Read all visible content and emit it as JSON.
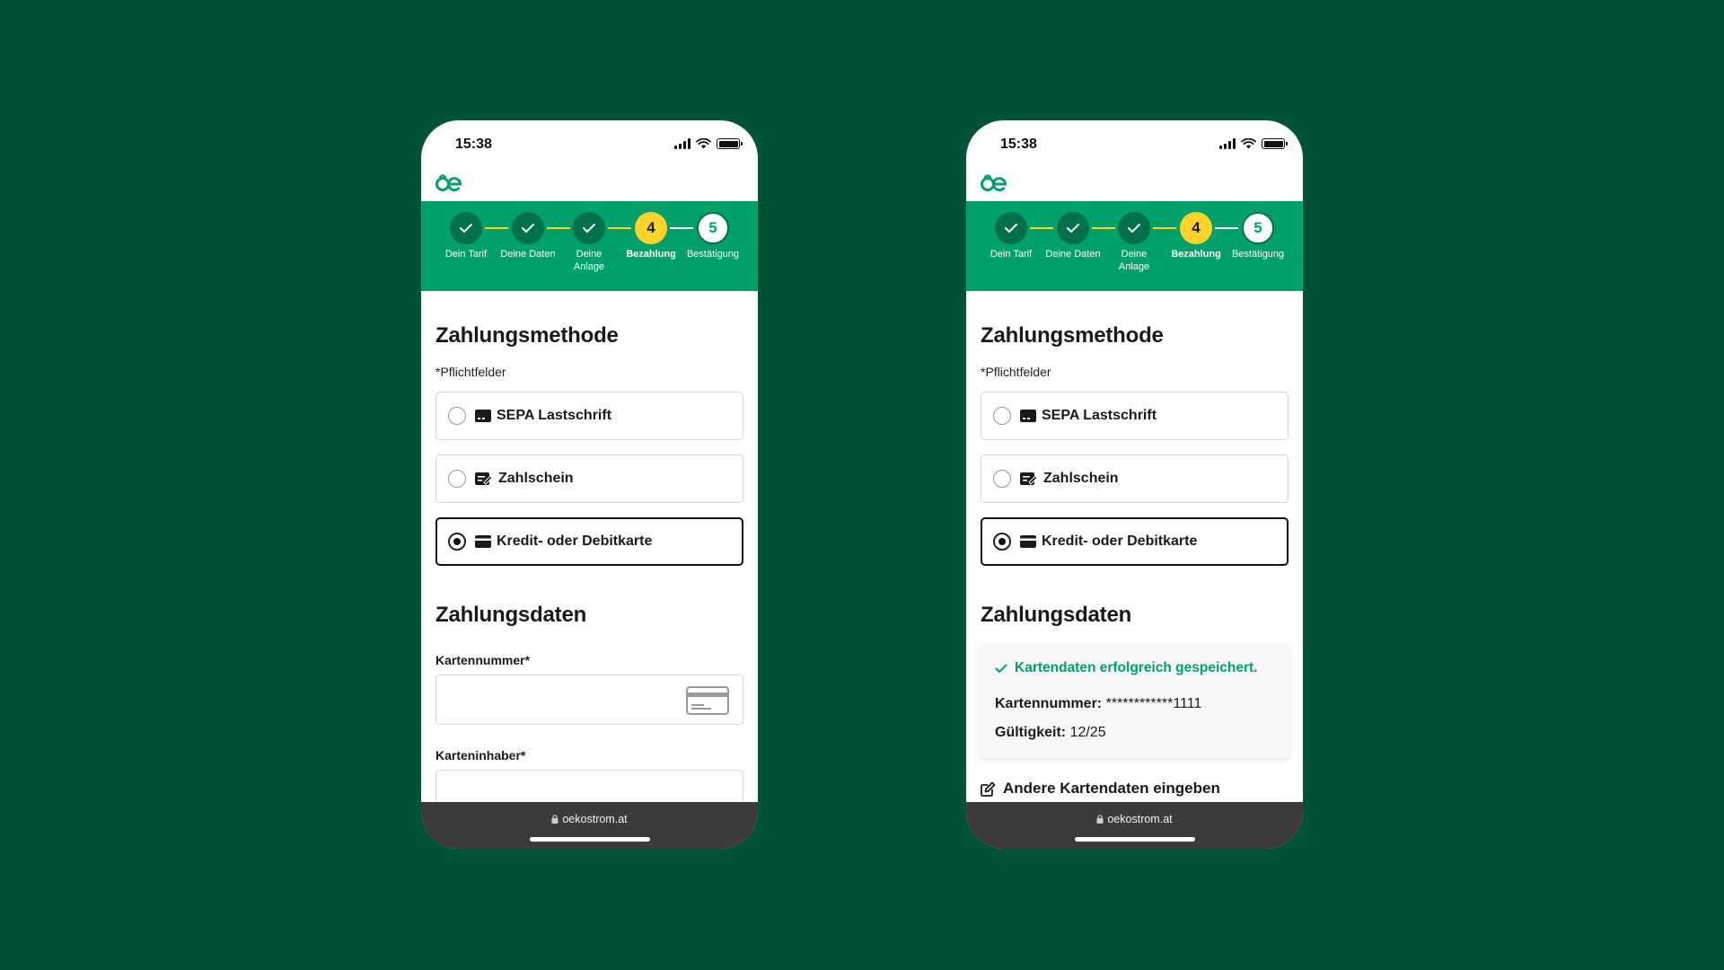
{
  "colors": {
    "background": "#005435",
    "brand_green": "#00a06b",
    "dark_green": "#00714a",
    "active_yellow": "#ffd32a",
    "browser_bar": "#3c3b39"
  },
  "status": {
    "time": "15:38",
    "icons": [
      "signal-icon",
      "wifi-icon",
      "battery-icon"
    ]
  },
  "stepper": {
    "steps": [
      {
        "label": "Dein Tarif",
        "state": "done"
      },
      {
        "label": "Deine Daten",
        "state": "done"
      },
      {
        "label": "Deine Anlage",
        "state": "done"
      },
      {
        "label": "Bezahlung",
        "state": "active",
        "number": "4"
      },
      {
        "label": "Bestätigung",
        "state": "todo",
        "number": "5"
      }
    ]
  },
  "payment": {
    "title": "Zahlungsmethode",
    "required_note": "*Pflichtfelder",
    "options": [
      {
        "label": "SEPA Lastschrift",
        "icon": "bank-card-icon",
        "selected": false
      },
      {
        "label": "Zahlschein",
        "icon": "payslip-icon",
        "selected": false
      },
      {
        "label": "Kredit- oder Debitkarte",
        "icon": "credit-card-icon",
        "selected": true
      }
    ]
  },
  "left_form": {
    "title": "Zahlungsdaten",
    "card_number_label": "Kartennummer*",
    "card_holder_label": "Karteninhaber*",
    "card_number_value": "",
    "card_holder_value": ""
  },
  "right_saved": {
    "title": "Zahlungsdaten",
    "success_message": "Kartendaten erfolgreich gespeichert.",
    "card_number_label": "Kartennummer:",
    "card_number_value": "************1111",
    "validity_label": "Gültigkeit:",
    "validity_value": "12/25",
    "edit_link": "Andere Kartendaten eingeben"
  },
  "browser": {
    "url": "oekostrom.at"
  }
}
